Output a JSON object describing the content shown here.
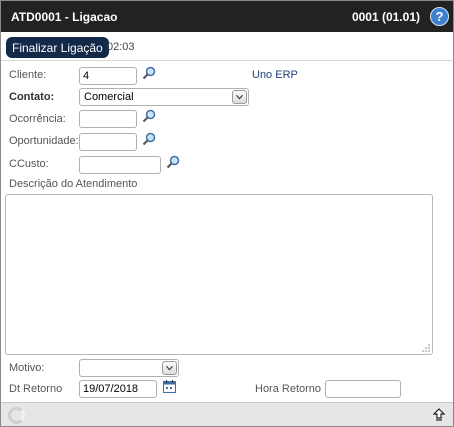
{
  "header": {
    "title": "ATD0001 - Ligacao",
    "version": "0001 (01.01)",
    "help_icon": "question-icon"
  },
  "toolbar": {
    "finish_label": "Finalizar Ligação",
    "timer": "02:03"
  },
  "form": {
    "cliente_label": "Cliente:",
    "cliente_value": "4",
    "cliente_name": "Uno ERP",
    "contato_label": "Contato:",
    "contato_value": "Comercial",
    "ocorrencia_label": "Ocorrência:",
    "ocorrencia_value": "",
    "oportunidade_label": "Oportunidade:",
    "oportunidade_value": "",
    "ccusto_label": "CCusto:",
    "ccusto_value": "",
    "descricao_label": "Descrição do Atendimento",
    "descricao_value": "",
    "motivo_label": "Motivo:",
    "motivo_value": "",
    "dt_retorno_label": "Dt Retorno",
    "dt_retorno_value": "19/07/2018",
    "hora_retorno_label": "Hora Retorno",
    "hora_retorno_value": ""
  },
  "icons": {
    "search": "search-icon",
    "dropdown": "chevron-down-icon",
    "calendar": "calendar-icon",
    "loading": "loading-spinner-icon",
    "scroll_top": "arrow-up-icon"
  },
  "colors": {
    "titlebar": "#222222",
    "button": "#13294a",
    "link": "#1f3f7a",
    "help": "#3f7fcf"
  }
}
